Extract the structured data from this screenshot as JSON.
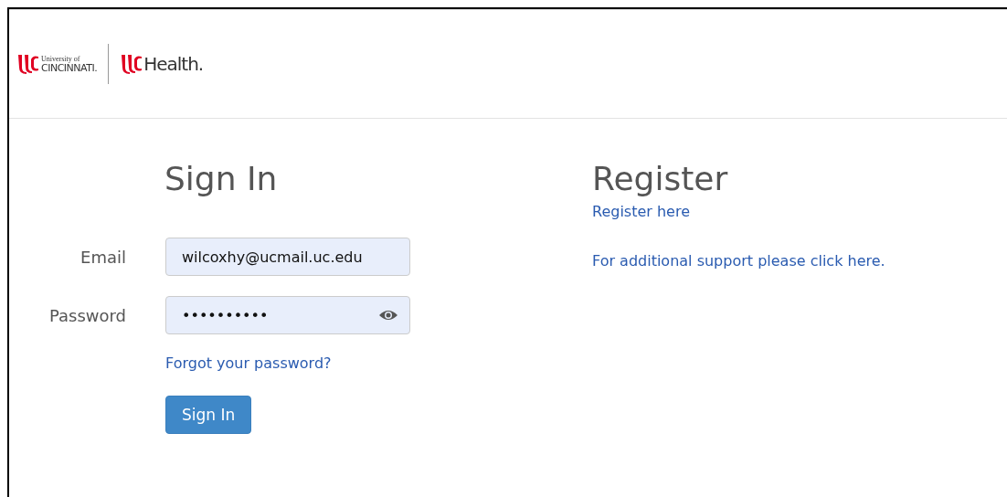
{
  "header": {
    "logo_left": {
      "small": "University of",
      "name": "CINCINNATI."
    },
    "logo_right": {
      "name": "Health."
    }
  },
  "sign_in": {
    "title": "Sign In",
    "fields": [
      {
        "label": "Email",
        "value": "wilcoxhy@ucmail.uc.edu",
        "kind": "text"
      },
      {
        "label": "Password",
        "value": "••••••••••",
        "kind": "password"
      }
    ],
    "forgot_link": "Forgot your password?",
    "button": "Sign In"
  },
  "register": {
    "title": "Register",
    "links": [
      "Register here",
      "For additional support please click here."
    ]
  }
}
